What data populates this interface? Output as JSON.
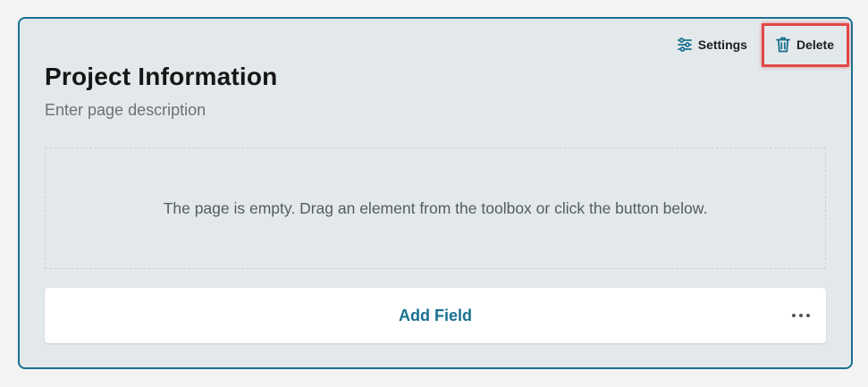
{
  "page": {
    "title": "Project Information",
    "description_placeholder": "Enter page description",
    "empty_message": "The page is empty. Drag an element from the toolbox or click the button below."
  },
  "actions": {
    "settings_label": "Settings",
    "delete_label": "Delete"
  },
  "add_field": {
    "label": "Add Field"
  },
  "icons": {
    "settings": "sliders-icon",
    "delete": "trash-icon",
    "more": "more-horizontal-icon"
  },
  "colors": {
    "accent": "#19708f",
    "card_background": "#e3e9eb",
    "highlight_border": "#e04848"
  }
}
